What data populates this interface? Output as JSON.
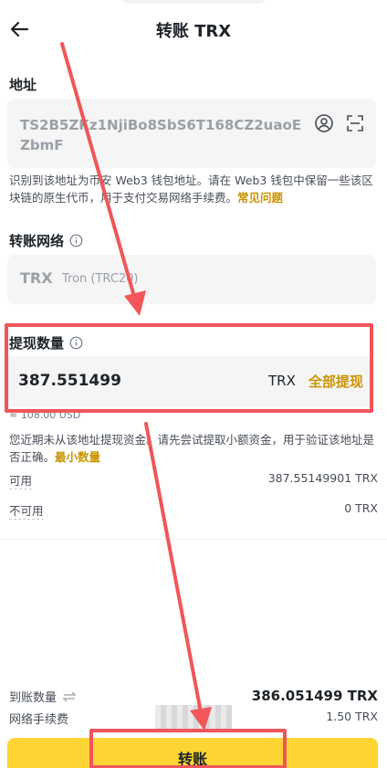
{
  "header": {
    "title": "转账 TRX"
  },
  "address": {
    "label": "地址",
    "value": "TS2B5ZKz1NjiBo8SbS6T168CZ2uaoEZbmF",
    "note": "识别到该地址为币安 Web3 钱包地址。请在 Web3 钱包中保留一些该区块链的原生代币，用于支付交易网络手续费。",
    "note_link": "常见问题"
  },
  "network": {
    "label": "转账网络",
    "main": "TRX",
    "sub": "Tron (TRC20)"
  },
  "amount": {
    "label": "提现数量",
    "value": "387.551499",
    "unit": "TRX",
    "max_label": "全部提现",
    "usd": "≈ 108.00 USD",
    "note": "您近期未从该地址提现资金。请先尝试提取小额资金，用于验证该地址是否正确。",
    "note_link": "最小数量"
  },
  "balances": [
    {
      "label": "可用",
      "value": "387.55149901 TRX"
    },
    {
      "label": "不可用",
      "value": "0 TRX"
    }
  ],
  "summary": {
    "receive_label": "到账数量",
    "receive_value": "386.051499 TRX",
    "fee_label": "网络手续费",
    "fee_value": "1.50 TRX"
  },
  "submit": {
    "label": "转账"
  },
  "annotation_color": "#f0565a"
}
